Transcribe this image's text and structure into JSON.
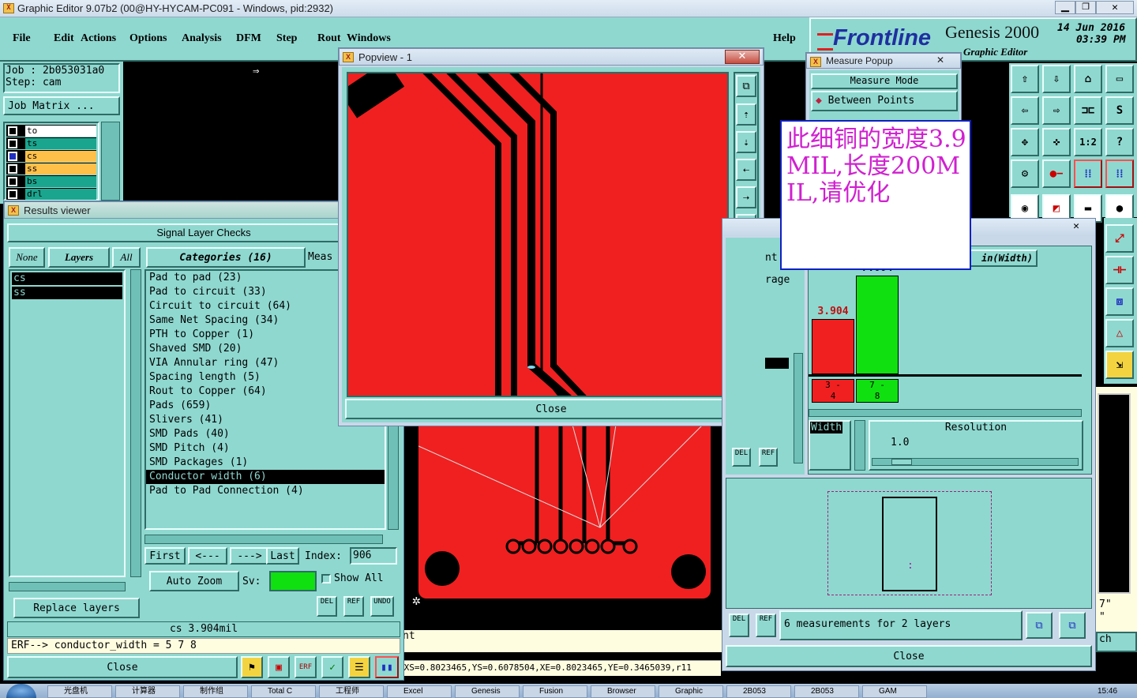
{
  "window": {
    "title": "Graphic Editor 9.07b2 (00@HY-HYCAM-PC091 - Windows, pid:2932)"
  },
  "menu": [
    "File",
    "Edit",
    "Actions",
    "Options",
    "Analysis",
    "DFM",
    "Step",
    "Rout",
    "Windows"
  ],
  "help": "Help",
  "brand": {
    "logo": "Frontline",
    "product": "Genesis 2000",
    "subtitle": "Graphic Editor",
    "date": "14 Jun 2016",
    "time": "03:39 PM"
  },
  "job": {
    "job": "Job : 2b053031a0",
    "step": "Step: cam",
    "matrix": "Job Matrix ..."
  },
  "layers": [
    {
      "name": "to",
      "color": "#ffffff"
    },
    {
      "name": "ts",
      "color": "#1aa58e"
    },
    {
      "name": "cs",
      "color": "#ffc04a"
    },
    {
      "name": "ss",
      "color": "#ffc04a"
    },
    {
      "name": "bs",
      "color": "#1aa58e"
    },
    {
      "name": "drl",
      "color": "#1aa58e"
    }
  ],
  "popview": {
    "title": "Popview - 1",
    "close": "Close"
  },
  "measure": {
    "title": "Measure Popup",
    "mode_label": "Measure Mode",
    "mode": "Between Points"
  },
  "annotation": "此细铜的宽度3.9MIL,长度200MIL,请优化",
  "results": {
    "title": "Results viewer",
    "header": "Signal Layer Checks",
    "none": "None",
    "layers": "Layers",
    "all": "All",
    "categories": "Categories (16)",
    "meas": "Meas",
    "layer_list": [
      "cs",
      "ss"
    ],
    "category_list": [
      "Pad to pad (23)",
      "Pad to circuit (33)",
      "Circuit to circuit (64)",
      "Same Net Spacing (34)",
      "PTH to Copper (1)",
      "Shaved SMD (20)",
      "VIA Annular ring (47)",
      "Spacing length (5)",
      "Rout to Copper (64)",
      "Pads (659)",
      "Slivers (41)",
      "SMD Pads (40)",
      "SMD Pitch (4)",
      "SMD Packages (1)",
      "Conductor width (6)",
      "Pad to Pad Connection (4)"
    ],
    "selected": "Conductor width (6)",
    "first": "First",
    "prev": "<---",
    "next": "--->",
    "last": "Last",
    "index_label": "Index:",
    "index": "906",
    "autozoom": "Auto Zoom",
    "sv": "Sv:",
    "showall": "Show All",
    "replace": "Replace layers",
    "del": "DEL",
    "ref": "REF",
    "undo": "UNDO",
    "status": "cs 3.904mil",
    "erf": "ERF--> conductor_width = 5 7 8",
    "close": "Close"
  },
  "histogram": {
    "title_suffix": "in(Width)",
    "bars": [
      {
        "label": "3.904",
        "range_top": "3 -",
        "range_bottom": "4",
        "value": 3.904,
        "color": "#f02020"
      },
      {
        "label": "7.004",
        "range_top": "7 -",
        "range_bottom": "8",
        "value": 7.004,
        "color": "#10e010"
      }
    ],
    "width_label": "Width",
    "resolution_label": "Resolution",
    "resolution": "1.0",
    "measurements": "6 measurements for 2 layers",
    "close": "Close",
    "del": "DEL",
    "ref": "REF",
    "partial": {
      "nt": "nt",
      "rage": "rage"
    }
  },
  "main_bottom": {
    "left_text": "nt",
    "coords": ",XS=0.8023465,YS=0.6078504,XE=0.8023465,YE=0.3465039,r11"
  },
  "right_side": {
    "a": "7\"",
    "b": "\"",
    "c": "ch"
  },
  "taskbar": [
    "光盘机",
    "计算器",
    "制作组",
    "Total C",
    "工程师",
    "Excel",
    "Genesis",
    "Fusion",
    "Browser",
    "Graphic",
    "2B053",
    "2B053",
    "GAM"
  ],
  "clock": "15:46"
}
